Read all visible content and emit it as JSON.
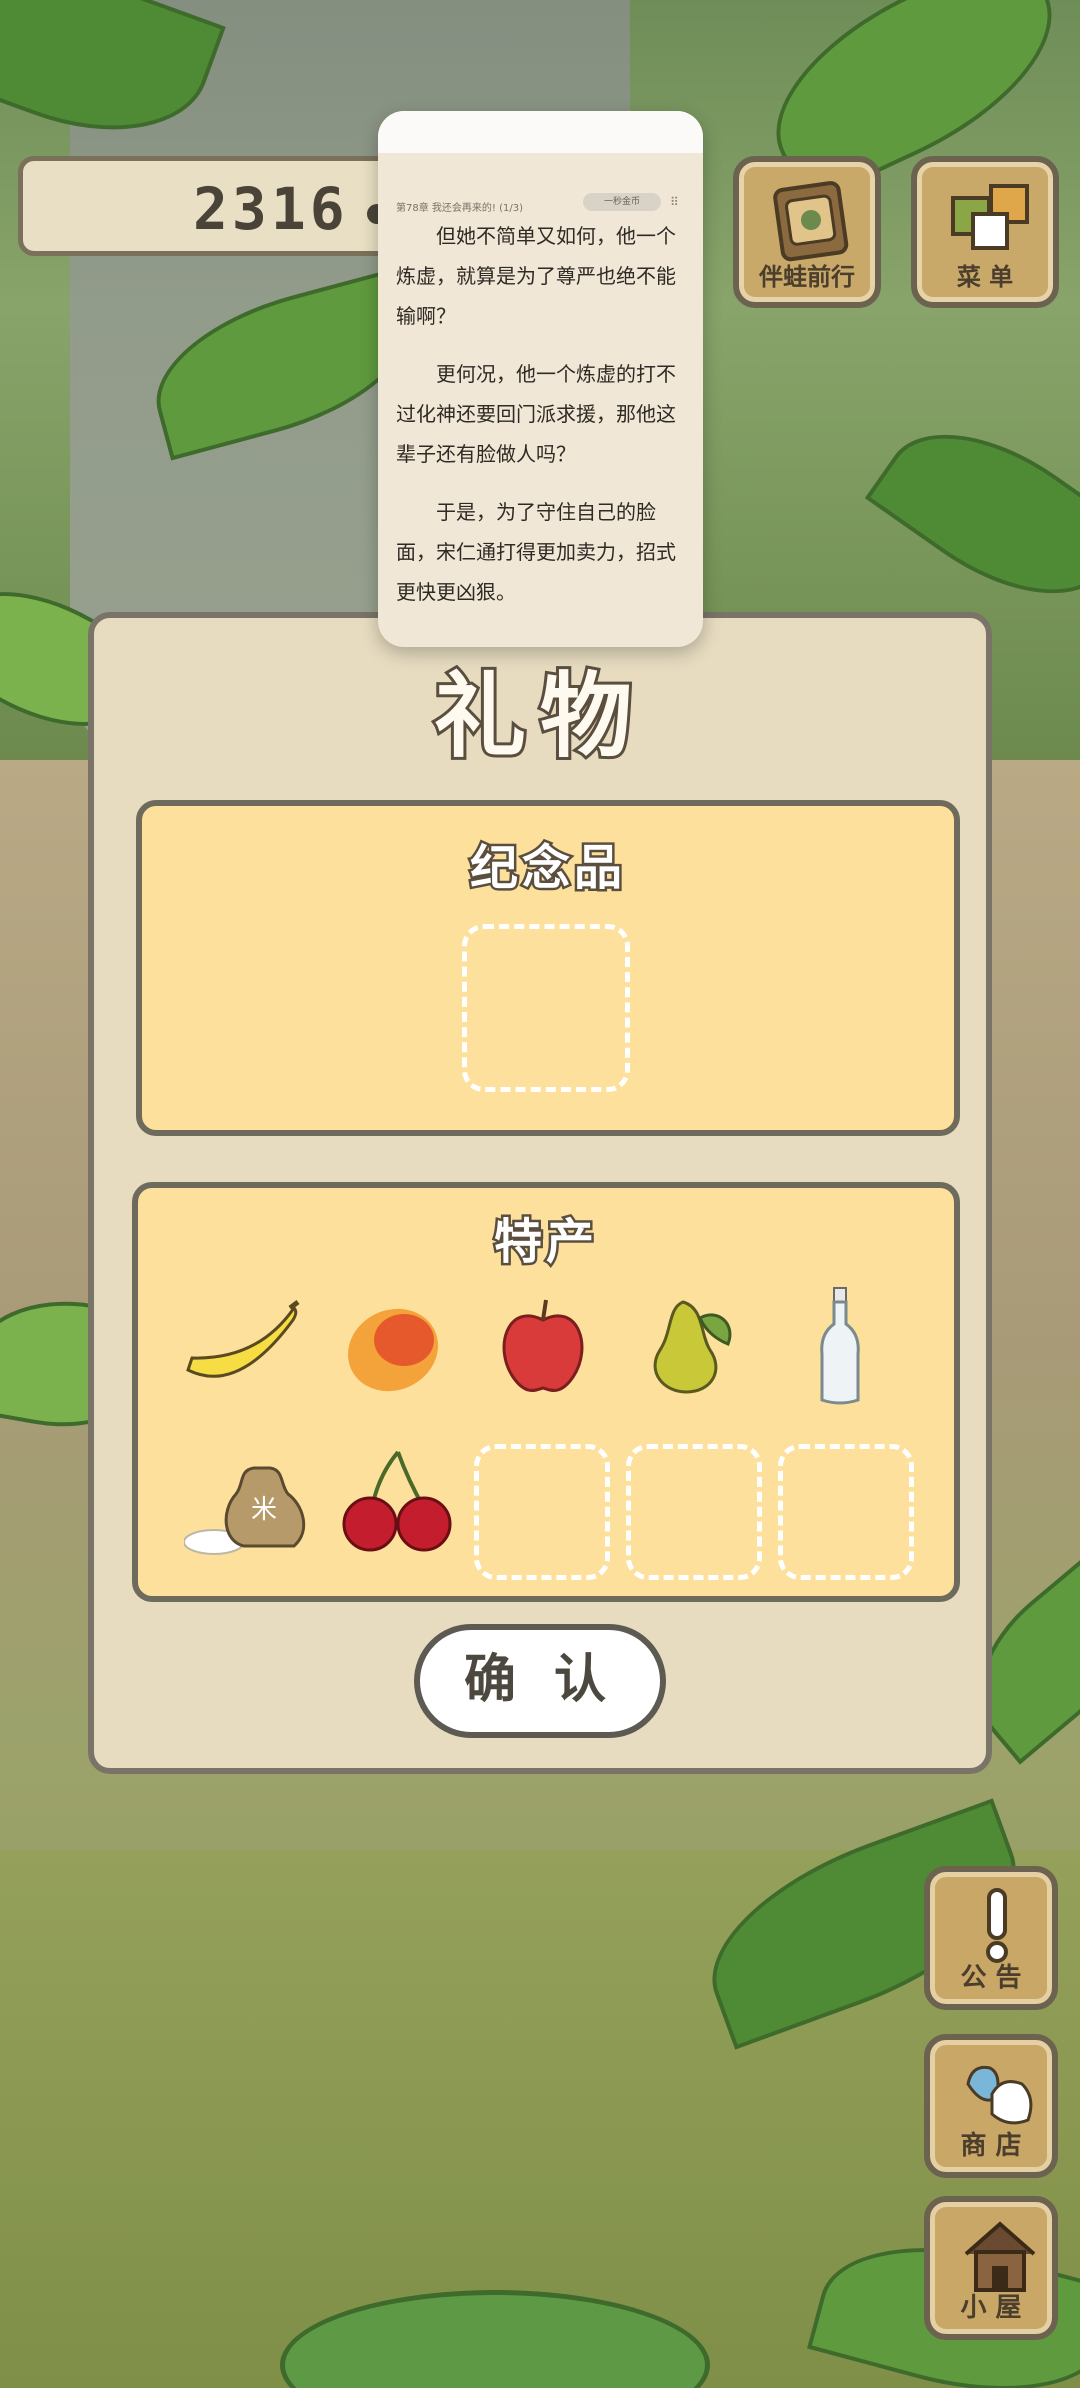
{
  "counter": {
    "value": "2316"
  },
  "top_buttons": {
    "travel_label": "伴蛙前行",
    "menu_label": "菜 单"
  },
  "reader": {
    "chapter": "第78章 我还会再来的! (1/3)",
    "pill": "一秒金币",
    "paragraphs": [
      "但她不简单又如何，他一个炼虚，就算是为了尊严也绝不能输啊？",
      "更何况，他一个炼虚的打不过化神还要回门派求援，那他这辈子还有脸做人吗？",
      "于是，为了守住自己的脸面，宋仁通打得更加卖力，招式更快更凶狠。"
    ]
  },
  "dialog": {
    "title": "礼物",
    "souvenir_title": "纪念品",
    "specialty_title": "特产",
    "specialty_items": [
      "banana",
      "mango",
      "apple",
      "pear",
      "bottle",
      "rice-bag",
      "cherries"
    ],
    "confirm_label": "确 认"
  },
  "side_buttons": {
    "notice_label": "公 告",
    "shop_label": "商 店",
    "house_label": "小 屋"
  }
}
